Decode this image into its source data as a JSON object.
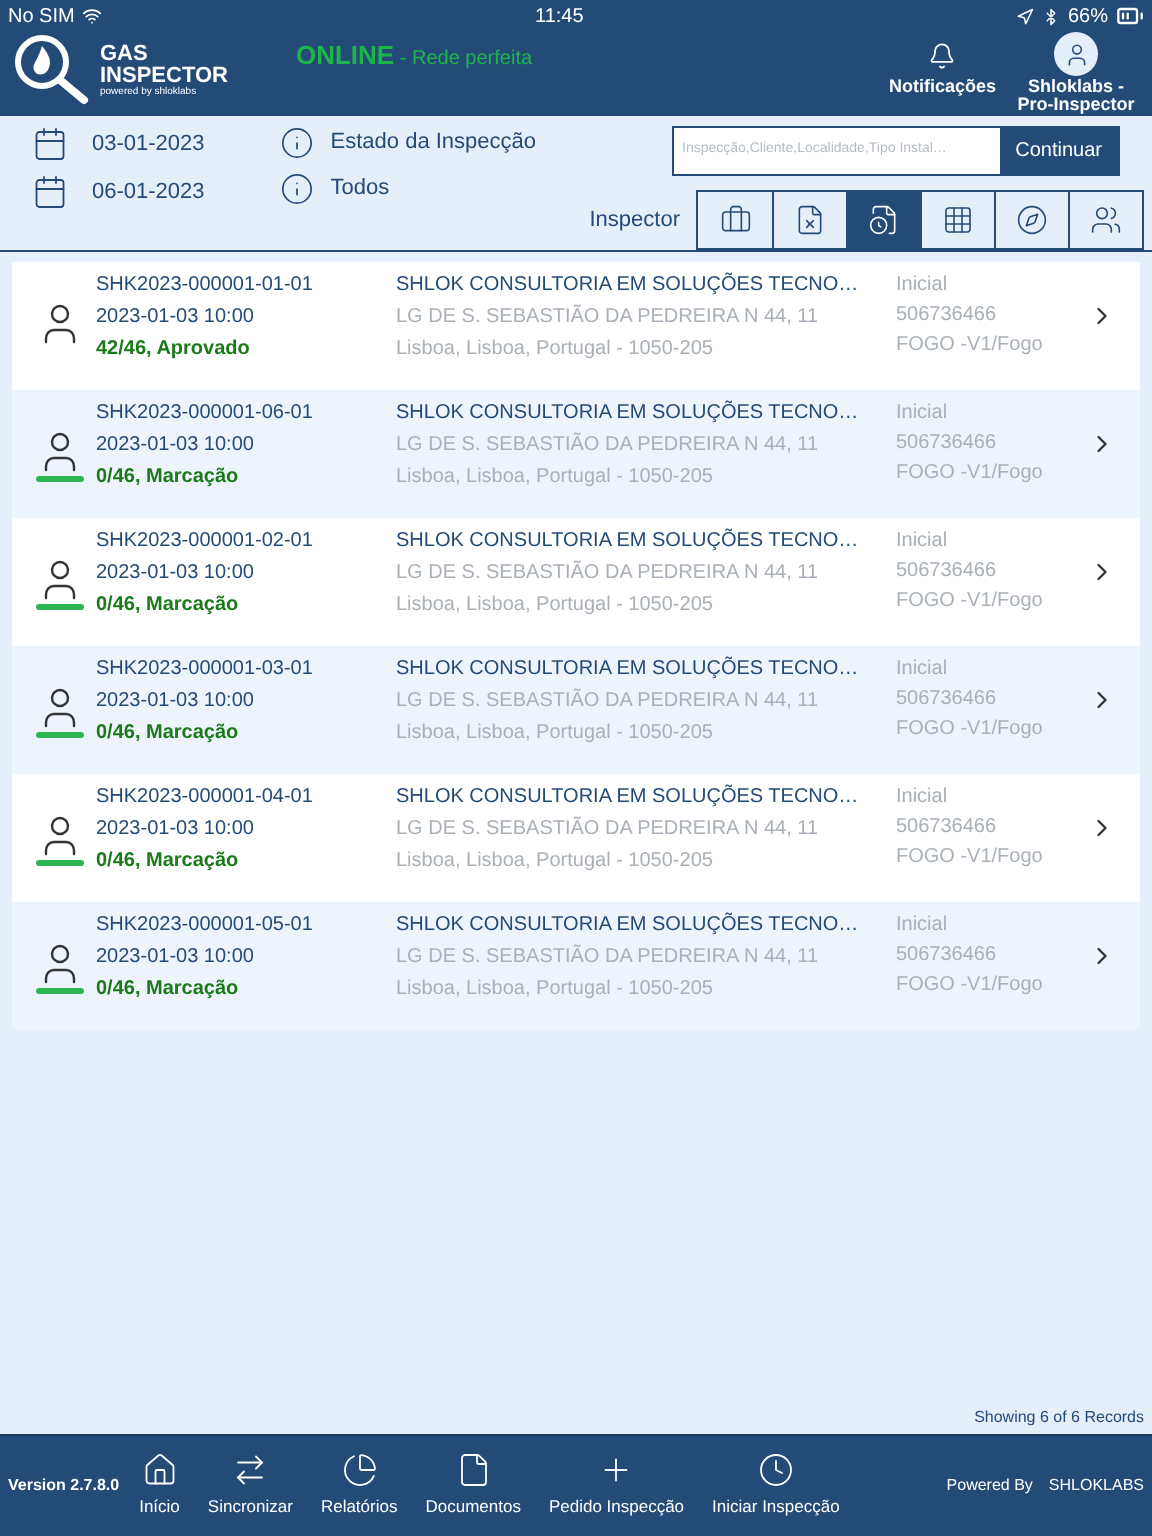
{
  "status_bar": {
    "carrier": "No SIM",
    "time": "11:45",
    "battery": "66%"
  },
  "header": {
    "logo_line1": "GAS",
    "logo_line2": "INSPECTOR",
    "logo_tagline": "powered by shloklabs",
    "online": "ONLINE",
    "network": " - Rede perfeita",
    "notifications": "Notificações",
    "user": "Shloklabs - Pro-Inspector"
  },
  "filters": {
    "date_from": "03-01-2023",
    "date_to": "06-01-2023",
    "state_label": "Estado da Inspecção",
    "state_value": "Todos",
    "search": {
      "placeholder": "Inspecção,Cliente,Localidade,Tipo Instal…"
    },
    "continue": "Continuar",
    "inspector_label": "Inspector"
  },
  "tabs": [
    {
      "kind": "briefcase",
      "selected": false
    },
    {
      "kind": "list-cancel",
      "selected": false
    },
    {
      "kind": "list-clock",
      "selected": true
    },
    {
      "kind": "grid",
      "selected": false
    },
    {
      "kind": "compass",
      "selected": false
    },
    {
      "kind": "group",
      "selected": false
    }
  ],
  "records": [
    {
      "code": "SHK2023-000001-01-01",
      "datetime": "2023-01-03 10:00",
      "progress": "42/46, Aprovado",
      "client": "SHLOK CONSULTORIA EM SOLUÇÕES TECNO…",
      "address": "LG DE S. SEBASTIÃO DA PEDREIRA N 44, 11",
      "locality": "Lisboa, Lisboa, Portugal - 1050-205",
      "type": "Inicial",
      "nif": "506736466",
      "category": "FOGO -V1/Fogo",
      "marked": false,
      "color": "#1a7a1a"
    },
    {
      "code": "SHK2023-000001-06-01",
      "datetime": "2023-01-03 10:00",
      "progress": "0/46, Marcação",
      "client": "SHLOK CONSULTORIA EM SOLUÇÕES TECNO…",
      "address": "LG DE S. SEBASTIÃO DA PEDREIRA N 44, 11",
      "locality": "Lisboa, Lisboa, Portugal - 1050-205",
      "type": "Inicial",
      "nif": "506736466",
      "category": "FOGO -V1/Fogo",
      "marked": true,
      "color": "#1a7a1a"
    },
    {
      "code": "SHK2023-000001-02-01",
      "datetime": "2023-01-03 10:00",
      "progress": "0/46, Marcação",
      "client": "SHLOK CONSULTORIA EM SOLUÇÕES TECNO…",
      "address": "LG DE S. SEBASTIÃO DA PEDREIRA N 44, 11",
      "locality": "Lisboa, Lisboa, Portugal - 1050-205",
      "type": "Inicial",
      "nif": "506736466",
      "category": "FOGO -V1/Fogo",
      "marked": true,
      "color": "#1a7a1a"
    },
    {
      "code": "SHK2023-000001-03-01",
      "datetime": "2023-01-03 10:00",
      "progress": "0/46, Marcação",
      "client": "SHLOK CONSULTORIA EM SOLUÇÕES TECNO…",
      "address": "LG DE S. SEBASTIÃO DA PEDREIRA N 44, 11",
      "locality": "Lisboa, Lisboa, Portugal - 1050-205",
      "type": "Inicial",
      "nif": "506736466",
      "category": "FOGO -V1/Fogo",
      "marked": true,
      "color": "#1a7a1a"
    },
    {
      "code": "SHK2023-000001-04-01",
      "datetime": "2023-01-03 10:00",
      "progress": "0/46, Marcação",
      "client": "SHLOK CONSULTORIA EM SOLUÇÕES TECNO…",
      "address": "LG DE S. SEBASTIÃO DA PEDREIRA N 44, 11",
      "locality": "Lisboa, Lisboa, Portugal - 1050-205",
      "type": "Inicial",
      "nif": "506736466",
      "category": "FOGO -V1/Fogo",
      "marked": true,
      "color": "#1a7a1a"
    },
    {
      "code": "SHK2023-000001-05-01",
      "datetime": "2023-01-03 10:00",
      "progress": "0/46, Marcação",
      "client": "SHLOK CONSULTORIA EM SOLUÇÕES TECNO…",
      "address": "LG DE S. SEBASTIÃO DA PEDREIRA N 44, 11",
      "locality": "Lisboa, Lisboa, Portugal - 1050-205",
      "type": "Inicial",
      "nif": "506736466",
      "category": "FOGO -V1/Fogo",
      "marked": true,
      "color": "#1a7a1a"
    }
  ],
  "records_count": "Showing 6 of 6 Records",
  "footer": {
    "version": "Version 2.7.8.0",
    "nav": [
      {
        "kind": "home",
        "label": "Início"
      },
      {
        "kind": "sync",
        "label": "Sincronizar"
      },
      {
        "kind": "reports",
        "label": "Relatórios"
      },
      {
        "kind": "document",
        "label": "Documentos"
      },
      {
        "kind": "plus",
        "label": "Pedido Inspecção"
      },
      {
        "kind": "clock",
        "label": "Iniciar Inspecção"
      }
    ],
    "powered_by": "Powered By",
    "brand": "SHLOKLABS"
  }
}
